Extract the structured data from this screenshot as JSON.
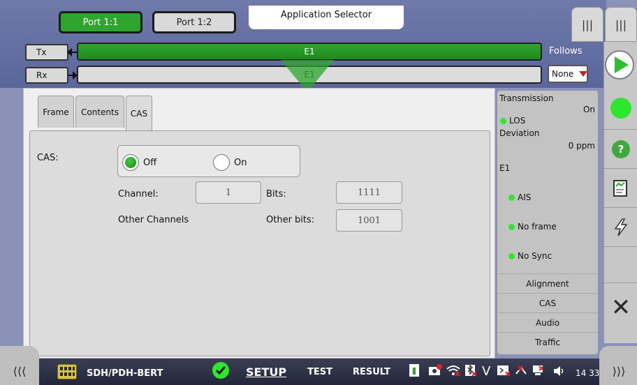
{
  "ports": [
    {
      "label": "Port 1:1",
      "active": true
    },
    {
      "label": "Port 1:2",
      "active": false
    }
  ],
  "app_selector": "Application Selector",
  "signal": {
    "tx_label": "Tx",
    "rx_label": "Rx",
    "tx_value": "E1",
    "rx_value": "E1",
    "follows_label": "Follows",
    "follows_value": "None"
  },
  "tabs": [
    {
      "label": "Frame"
    },
    {
      "label": "Contents"
    },
    {
      "label": "CAS",
      "selected": true
    }
  ],
  "cas": {
    "label": "CAS:",
    "off_label": "Off",
    "on_label": "On",
    "selected": "Off",
    "channel_label": "Channel:",
    "channel_value": "1",
    "bits_label": "Bits:",
    "bits_value": "1111",
    "other_channels_label": "Other Channels",
    "other_bits_label": "Other bits:",
    "other_bits_value": "1001"
  },
  "status": {
    "transmission_label": "Transmission",
    "transmission_value": "On",
    "los_label": "LOS",
    "deviation_label": "Deviation",
    "deviation_value": "0 ppm",
    "e1_label": "E1",
    "ais_label": "AIS",
    "no_frame_label": "No frame",
    "no_sync_label": "No Sync",
    "sections": [
      "Alignment",
      "CAS",
      "Audio",
      "Traffic"
    ],
    "led_color": "#2ee62e"
  },
  "bottom": {
    "app_name": "SDH/PDH-BERT",
    "tabs": [
      "SETUP",
      "TEST",
      "RESULT"
    ],
    "active_tab": "SETUP",
    "clock": "14 33"
  },
  "colors": {
    "accent_green": "#2ea52e",
    "danger_red": "#c0202a"
  }
}
